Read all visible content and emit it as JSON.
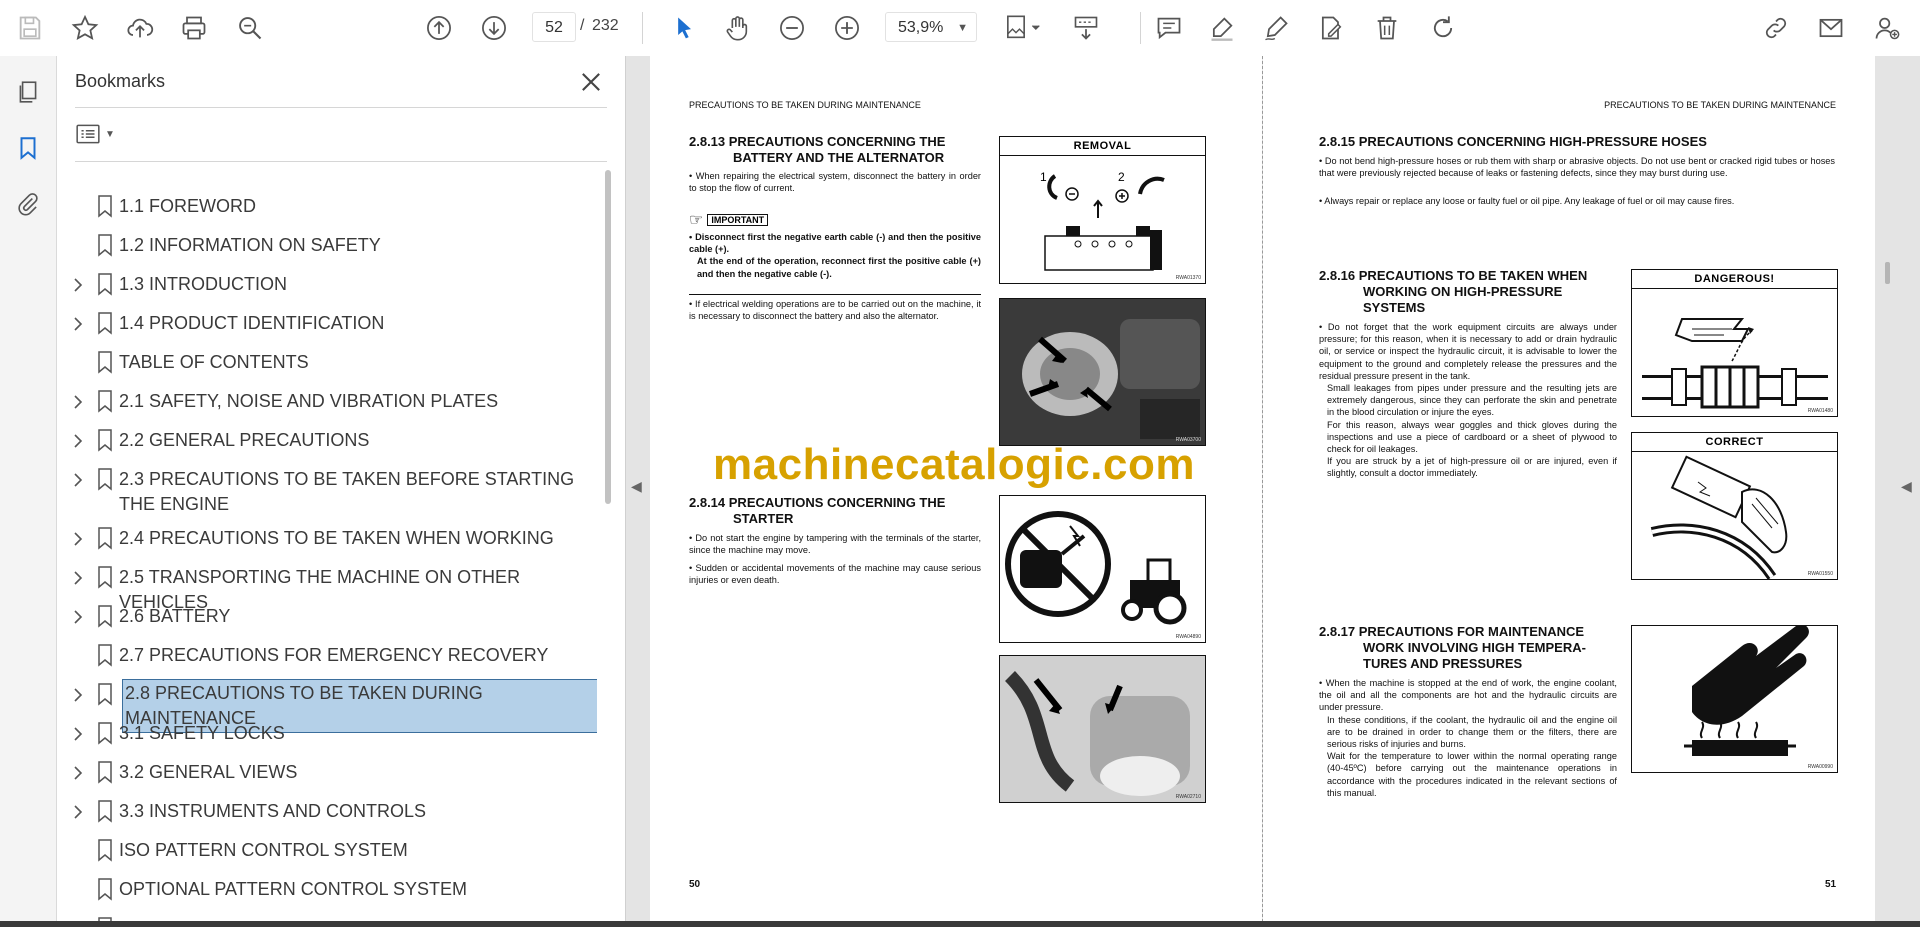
{
  "toolbar": {
    "page_current": "52",
    "page_sep": "/",
    "page_total": "232",
    "zoom": "53,9%"
  },
  "panel": {
    "title": "Bookmarks",
    "items": [
      {
        "label": "1.1 FOREWORD",
        "expandable": false
      },
      {
        "label": "1.2 INFORMATION ON SAFETY",
        "expandable": false
      },
      {
        "label": "1.3 INTRODUCTION",
        "expandable": true
      },
      {
        "label": "1.4 PRODUCT IDENTIFICATION",
        "expandable": true
      },
      {
        "label": "TABLE OF CONTENTS",
        "expandable": false
      },
      {
        "label": "2.1 SAFETY, NOISE AND VIBRATION PLATES",
        "expandable": true
      },
      {
        "label": "2.2 GENERAL PRECAUTIONS",
        "expandable": true
      },
      {
        "label": "2.3 PRECAUTIONS TO BE TAKEN BEFORE STARTING THE ENGINE",
        "expandable": true
      },
      {
        "label": "2.4 PRECAUTIONS TO BE TAKEN WHEN WORKING",
        "expandable": true
      },
      {
        "label": "2.5 TRANSPORTING THE MACHINE ON OTHER VEHICLES",
        "expandable": true
      },
      {
        "label": "2.6 BATTERY",
        "expandable": true
      },
      {
        "label": "2.7 PRECAUTIONS FOR EMERGENCY RECOVERY",
        "expandable": false
      },
      {
        "label": "2.8 PRECAUTIONS TO BE TAKEN DURING MAINTENANCE",
        "expandable": true,
        "selected": true
      },
      {
        "label": "3.1 SAFETY LOCKS",
        "expandable": true
      },
      {
        "label": "3.2 GENERAL VIEWS",
        "expandable": true
      },
      {
        "label": "3.3 INSTRUMENTS AND CONTROLS",
        "expandable": true
      },
      {
        "label": "ISO PATTERN CONTROL SYSTEM",
        "expandable": false
      },
      {
        "label": "OPTIONAL PATTERN CONTROL SYSTEM",
        "expandable": false
      },
      {
        "label": "3.4 FUSES AND RELAYS",
        "expandable": true
      }
    ]
  },
  "doc": {
    "header_left": "PRECAUTIONS TO BE TAKEN DURING MAINTENANCE",
    "header_right": "PRECAUTIONS TO BE TAKEN DURING MAINTENANCE",
    "watermark": "machinecatalogic.com",
    "page_left": "50",
    "page_right": "51",
    "s13_title_1": "2.8.13 PRECAUTIONS CONCERNING THE",
    "s13_title_2": "BATTERY AND THE ALTERNATOR",
    "s13_p1": "• When repairing the electrical system, disconnect the battery in order to stop the flow of current.",
    "important_label": "IMPORTANT",
    "s13_imp_1": "• Disconnect first the negative earth cable (-) and then the positive cable (+).",
    "s13_imp_2": "At the end of the operation, reconnect first the positive cable (+) and then the negative cable (-).",
    "s13_p2": "• If electrical welding operations are to be carried out on the machine, it is necessary to disconnect the battery and also the alternator.",
    "removal_caption": "REMOVAL",
    "removal_code": "RWA01370",
    "photo1_code": "RWA03700",
    "s14_title_1": "2.8.14 PRECAUTIONS CONCERNING THE",
    "s14_title_2": "STARTER",
    "s14_p1": "• Do not start the engine by tampering with the terminals of the starter, since the machine may move.",
    "s14_p2": "• Sudden or accidental movements of the machine may cause serious injuries or even death.",
    "starter_code": "RWA04890",
    "photo2_code": "RWA02710",
    "s15_title": "2.8.15 PRECAUTIONS CONCERNING HIGH-PRESSURE HOSES",
    "s15_p1": "• Do not bend high-pressure hoses or rub them with sharp or abrasive objects. Do not use bent or cracked rigid tubes or hoses that were previously rejected because of leaks or fastening defects, since they may burst during use.",
    "s15_p2": "• Always repair or replace any loose or faulty fuel or oil pipe. Any leakage of fuel or oil may cause fires.",
    "s16_title_1": "2.8.16 PRECAUTIONS TO BE TAKEN WHEN",
    "s16_title_2": "WORKING ON HIGH-PRESSURE",
    "s16_title_3": "SYSTEMS",
    "s16_p1": "• Do not forget that the work equipment circuits are always under pressure; for this reason, when it is necessary to add or drain hydraulic oil, or service or inspect the hydraulic circuit, it is advisable to lower the equipment to the ground and completely release the pressures and the residual pressure present in the tank.",
    "s16_p2": "Small leakages from pipes under pressure and the resulting jets are extremely dangerous, since they can perforate the skin and penetrate in the blood circulation or injure the eyes.",
    "s16_p3": "For this reason, always wear goggles and thick gloves during the inspections and use a piece of cardboard or a sheet of plywood to check for oil leakages.",
    "s16_p4": "If you are struck by a jet of high-pressure oil or are injured, even if slightly, consult a doctor immediately.",
    "dangerous_caption": "DANGEROUS!",
    "dangerous_code": "RWA01480",
    "correct_caption": "CORRECT",
    "correct_code": "RWA01550",
    "s17_title_1": "2.8.17 PRECAUTIONS FOR MAINTENANCE",
    "s17_title_2": "WORK INVOLVING HIGH TEMPERA-",
    "s17_title_3": "TURES AND PRESSURES",
    "s17_p1": "• When the machine is stopped at the end of work, the engine coolant, the oil and all the components are hot and the hydraulic circuits are under pressure.",
    "s17_p2": "In these conditions, if the coolant, the hydraulic oil and the engine oil are to be drained in order to change them or the filters, there are serious risks of injuries and burns.",
    "s17_p3": "Wait for the temperature to lower within the normal operating range (40-45ºC) before carrying out the maintenance operations in accordance with the procedures indicated in the relevant sections of this manual.",
    "hot_code": "RWA00990",
    "removal_labels": [
      "1",
      "2"
    ]
  }
}
